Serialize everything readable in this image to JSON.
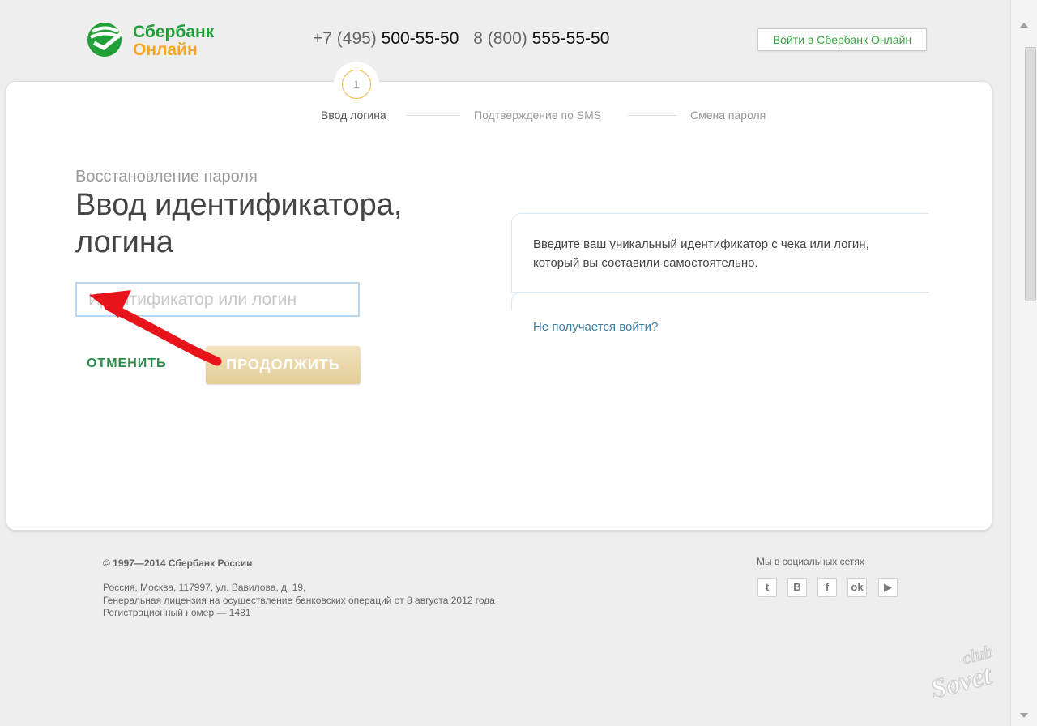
{
  "header": {
    "logo": {
      "line1": "Сбербанк",
      "line2": "Онлайн",
      "green": "#21a038",
      "orange": "#f5a623"
    },
    "phones": [
      {
        "code": "+7 (495)",
        "number": "500-55-50"
      },
      {
        "code": "8 (800)",
        "number": "555-55-50"
      }
    ],
    "login_button": "Войти в Сбербанк Онлайн"
  },
  "steps": {
    "current_number": "1",
    "items": [
      "Ввод логина",
      "Подтверждение по SMS",
      "Смена пароля"
    ]
  },
  "form": {
    "subtitle": "Восстановление пароля",
    "title": "Ввод идентификатора, логина",
    "input_placeholder": "Идентификатор или логин",
    "cancel": "ОТМЕНИТЬ",
    "continue": "ПРОДОЛЖИТЬ"
  },
  "hint": {
    "text": "Введите ваш уникальный идентификатор с чека или логин, который вы составили самостоятельно.",
    "help_link": "Не получается войти?"
  },
  "footer": {
    "copyright": "© 1997—2014 Сбербанк России",
    "address_lines": [
      "Россия, Москва, 117997, ул. Вавилова, д. 19,",
      "Генеральная лицензия на осуществление банковских операций от 8 августа 2012 года",
      "Регистрационный номер — 1481"
    ],
    "social_title": "Мы в социальных сетях",
    "social": [
      {
        "icon": "twitter-icon",
        "glyph": "t"
      },
      {
        "icon": "vk-icon",
        "glyph": "B"
      },
      {
        "icon": "facebook-icon",
        "glyph": "f"
      },
      {
        "icon": "odnoklassniki-icon",
        "glyph": "ok"
      },
      {
        "icon": "youtube-icon",
        "glyph": "▶"
      }
    ]
  },
  "watermark": "club Sovet",
  "colors": {
    "accent_green": "#35a33e",
    "gold_button": "#e9d4a2",
    "link_blue": "#3a7ea6",
    "arrow_red": "#e8141c"
  }
}
